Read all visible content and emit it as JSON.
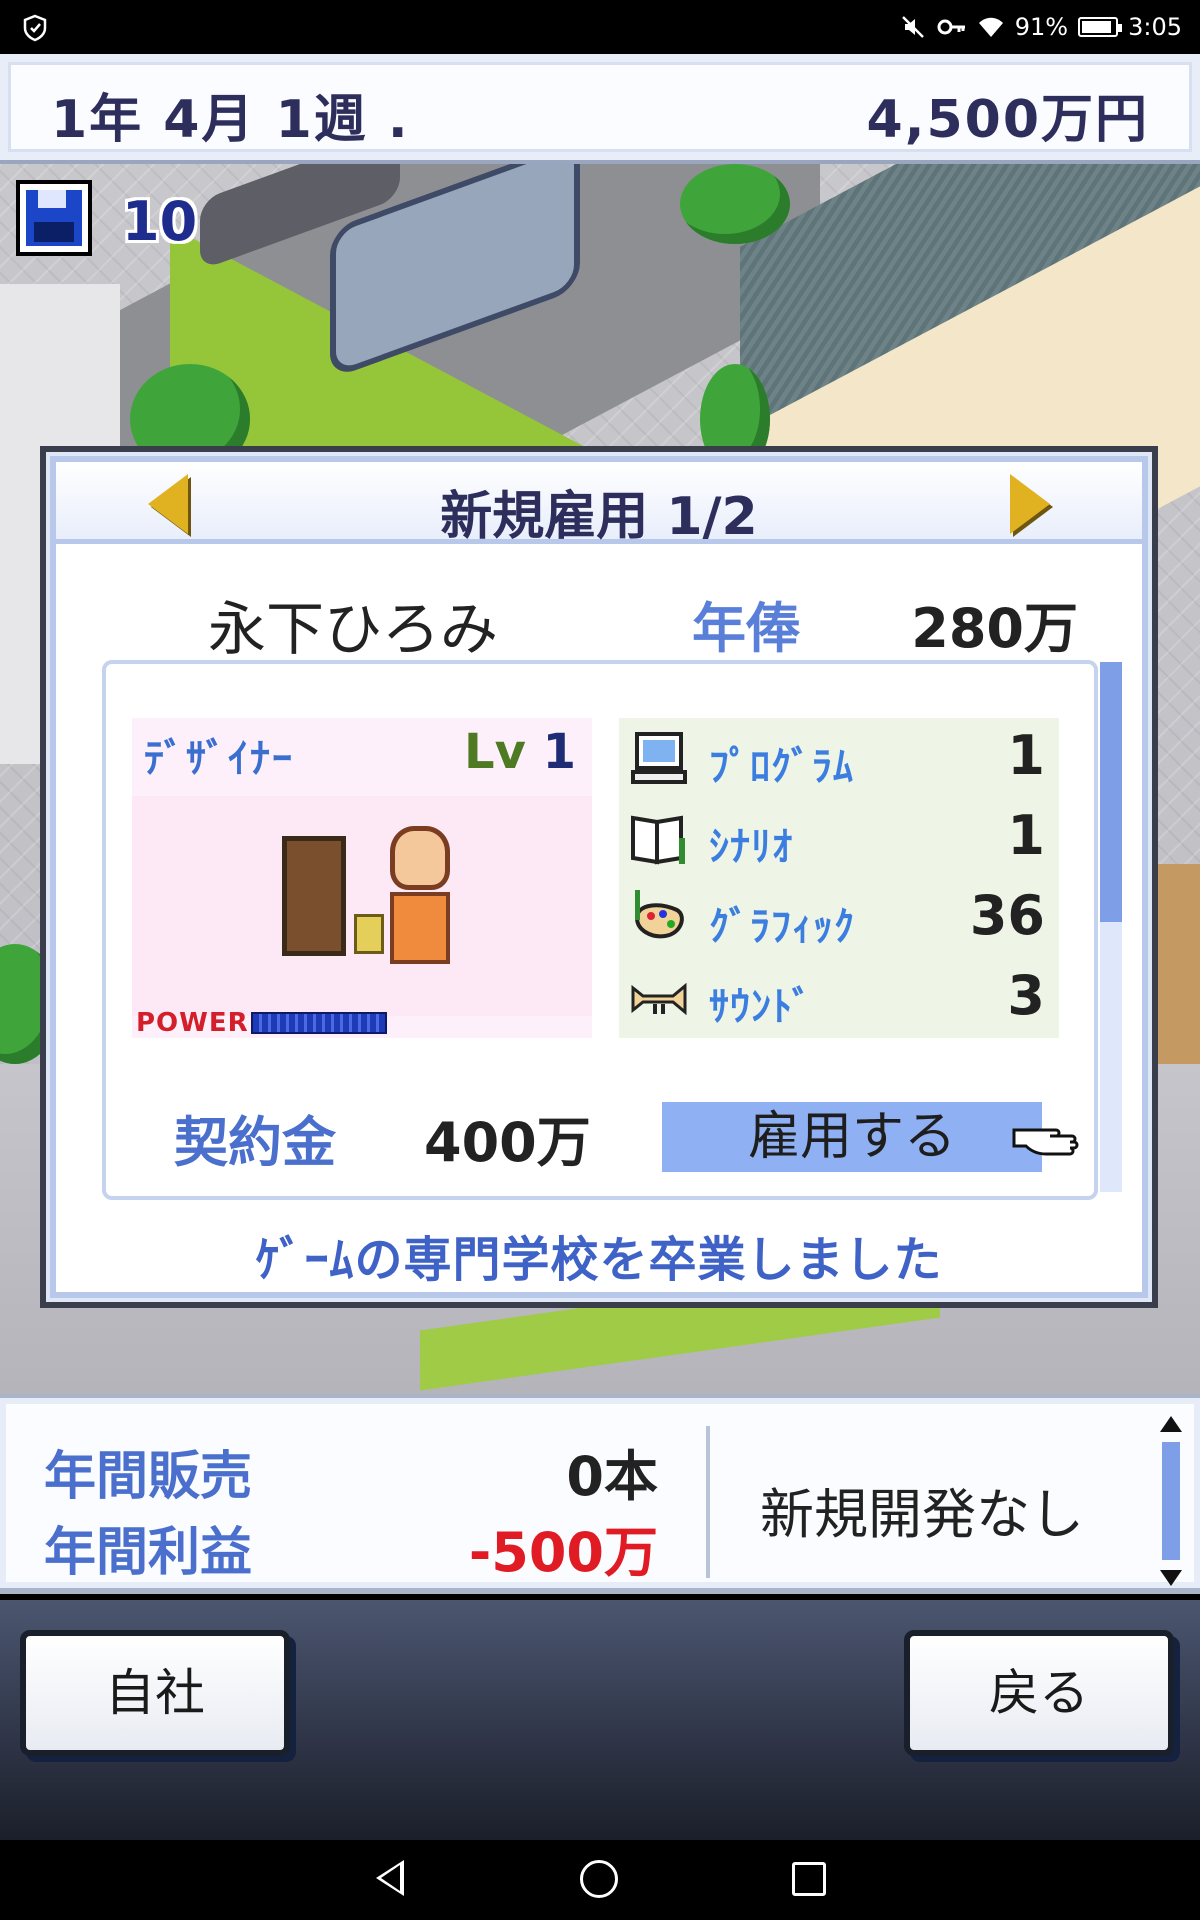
{
  "status_bar": {
    "battery": "91%",
    "time": "3:05",
    "battery_level": 0.91,
    "icons": [
      "shield-icon",
      "mute-icon",
      "key-icon",
      "wifi-icon",
      "battery-icon"
    ]
  },
  "header": {
    "date": "1年 4月 1週 .",
    "money": "4,500万円"
  },
  "save": {
    "count": "10",
    "icon": "floppy-disk-icon"
  },
  "dialog": {
    "title": "新規雇用 1/2",
    "employee": {
      "name": "永下ひろみ",
      "salary_label": "年俸",
      "salary": "280万",
      "role": "ﾃﾞｻﾞｲﾅｰ",
      "level_prefix": "Lv",
      "level": "1",
      "power_label": "POWER",
      "stats": [
        {
          "label": "ﾌﾟﾛｸﾞﾗﾑ",
          "value": "1",
          "icon": "computer-icon"
        },
        {
          "label": "ｼﾅﾘｵ",
          "value": "1",
          "icon": "book-icon"
        },
        {
          "label": "ｸﾞﾗﾌｨｯｸ",
          "value": "36",
          "icon": "palette-icon"
        },
        {
          "label": "ｻｳﾝﾄﾞ",
          "value": "3",
          "icon": "trumpet-icon"
        }
      ]
    },
    "contract_label": "契約金",
    "contract_fee": "400万",
    "hire_button": "雇用する",
    "description": "ｹﾞｰﾑの専門学校を卒業しました"
  },
  "info_panel": {
    "annual_sales_label": "年間販売",
    "annual_sales": "0本",
    "annual_profit_label": "年間利益",
    "annual_profit": "-500万",
    "dev_status": "新規開発なし",
    "profit_color": "#e01b24"
  },
  "buttons": {
    "home": "自社",
    "back": "戻る"
  },
  "colors": {
    "accent": "#4a6fcc",
    "hire_button_bg": "#8fb0f2",
    "title_text": "#2d2e5c"
  }
}
